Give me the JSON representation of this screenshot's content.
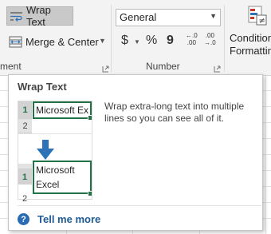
{
  "ribbon": {
    "wrap_text_label": "Wrap Text",
    "merge_center_label": "Merge & Center",
    "alignment_group_partial": "ment",
    "number_group": "Number",
    "number_format_value": "General",
    "currency_symbol": "$",
    "percent_symbol": "%",
    "comma_symbol": "9",
    "decimal_increase_top": "←.0",
    "decimal_increase_bottom": ".00",
    "decimal_decrease_top": ".00",
    "decimal_decrease_bottom": "→.0",
    "conditional_line1": "Condition",
    "conditional_line2": "Formattin"
  },
  "tooltip": {
    "title": "Wrap Text",
    "description": "Wrap extra-long text into multiple lines so you can see all of it.",
    "help_link": "Tell me more",
    "help_icon_glyph": "?"
  },
  "illustration": {
    "before_row1": "1",
    "before_row2": "2",
    "before_cell": "Microsoft Ex",
    "after_row1": "1",
    "after_row2": "2",
    "after_line1": "Microsoft",
    "after_line2": "Excel"
  },
  "colors": {
    "accent_green": "#217346",
    "arrow_blue": "#2e73b8",
    "link_blue": "#1f5a94"
  },
  "icons": {
    "wrap_text": "wrap-text-icon",
    "merge": "merge-center-icon",
    "conditional": "conditional-formatting-icon",
    "help": "help-icon",
    "down_arrow": "down-arrow-icon"
  }
}
